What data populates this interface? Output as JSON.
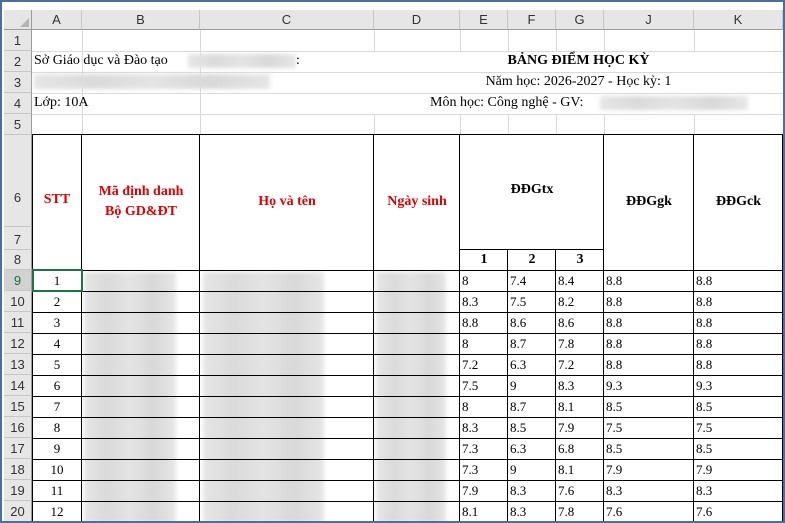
{
  "columns": [
    "A",
    "B",
    "C",
    "D",
    "E",
    "F",
    "G",
    "J",
    "K"
  ],
  "row_numbers": [
    "1",
    "2",
    "3",
    "4",
    "5",
    "6",
    "7",
    "8",
    "9",
    "10",
    "11",
    "12",
    "13",
    "14",
    "15",
    "16",
    "17",
    "18",
    "19",
    "20"
  ],
  "header": {
    "department_prefix": "Sở Giáo dục và Đào tạo",
    "department_colon": ":",
    "title": "BẢNG ĐIỂM HỌC KỲ",
    "school_year": "Năm học: 2026-2027 - Học kỳ: 1",
    "class_label": "Lớp: 10A",
    "subject_teacher": "Môn học: Công nghệ - GV:"
  },
  "table_headers": {
    "stt": "STT",
    "id_line1": "Mã định danh",
    "id_line2": "Bộ GD&ĐT",
    "name": "Họ và tên",
    "dob": "Ngày sinh",
    "ddgtx": "ĐĐGtx",
    "sub1": "1",
    "sub2": "2",
    "sub3": "3",
    "ddggk": "ĐĐGgk",
    "ddgck": "ĐĐGck"
  },
  "rows": [
    {
      "stt": "1",
      "e": "8",
      "f": "7.4",
      "g": "8.4",
      "j": "8.8",
      "k": "8.8"
    },
    {
      "stt": "2",
      "e": "8.3",
      "f": "7.5",
      "g": "8.2",
      "j": "8.8",
      "k": "8.8"
    },
    {
      "stt": "3",
      "e": "8.8",
      "f": "8.6",
      "g": "8.6",
      "j": "8.8",
      "k": "8.8"
    },
    {
      "stt": "4",
      "e": "8",
      "f": "8.7",
      "g": "7.8",
      "j": "8.8",
      "k": "8.8"
    },
    {
      "stt": "5",
      "e": "7.2",
      "f": "6.3",
      "g": "7.2",
      "j": "8.8",
      "k": "8.8"
    },
    {
      "stt": "6",
      "e": "7.5",
      "f": "9",
      "g": "8.3",
      "j": "9.3",
      "k": "9.3"
    },
    {
      "stt": "7",
      "e": "8",
      "f": "8.7",
      "g": "8.1",
      "j": "8.5",
      "k": "8.5"
    },
    {
      "stt": "8",
      "e": "8.3",
      "f": "8.5",
      "g": "7.9",
      "j": "7.5",
      "k": "7.5"
    },
    {
      "stt": "9",
      "e": "7.3",
      "f": "6.3",
      "g": "6.8",
      "j": "8.5",
      "k": "8.5"
    },
    {
      "stt": "10",
      "e": "7.3",
      "f": "9",
      "g": "8.1",
      "j": "7.9",
      "k": "7.9"
    },
    {
      "stt": "11",
      "e": "7.9",
      "f": "8.3",
      "g": "7.6",
      "j": "8.3",
      "k": "8.3"
    },
    {
      "stt": "12",
      "e": "8.1",
      "f": "8.3",
      "g": "7.8",
      "j": "7.6",
      "k": "7.6"
    }
  ]
}
